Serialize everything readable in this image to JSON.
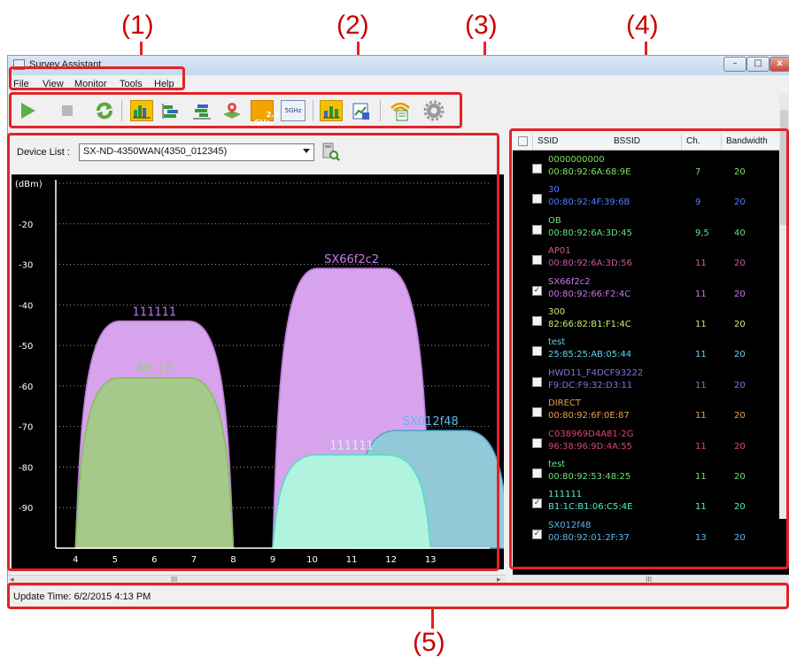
{
  "callouts": [
    "(1)",
    "(2)",
    "(3)",
    "(4)",
    "(5)"
  ],
  "window": {
    "title": "Survey Assistant",
    "buttons": {
      "minimize": "–",
      "maximize": "□",
      "close": "x"
    }
  },
  "menu": [
    "File",
    "View",
    "Monitor",
    "Tools",
    "Help"
  ],
  "toolbar": [
    "play-icon",
    "stop-icon",
    "refresh-icon",
    "channel-graph-icon",
    "channel-graph-alt-icon",
    "time-graph-icon",
    "map-icon",
    "2.4 GHz",
    "5GHz",
    "bar-graph-icon",
    "report-icon",
    "wifi-list-icon",
    "gear-icon"
  ],
  "toolbar_labels": {
    "band24": "2.4\nGHz",
    "band5": "5GHz"
  },
  "device": {
    "label": "Device List :",
    "selected": "SX-ND-4350WAN(4350_012345)"
  },
  "list": {
    "headers": [
      "SSID",
      "BSSID",
      "Ch.",
      "Bandwidth"
    ],
    "rows": [
      {
        "ssid": "0000000000",
        "bssid": "00:80:92:6A:68:9E",
        "ch": "7",
        "bw": "20",
        "checked": false,
        "color": "#7fe35f"
      },
      {
        "ssid": "30",
        "bssid": "00:80:92:4F:39:6B",
        "ch": "9",
        "bw": "20",
        "checked": false,
        "color": "#4f7fff"
      },
      {
        "ssid": "OB",
        "bssid": "00:80:92:6A:3D:45",
        "ch": "9,5",
        "bw": "40",
        "checked": false,
        "color": "#63e08a"
      },
      {
        "ssid": "AP01",
        "bssid": "00:80:92:6A:3D:56",
        "ch": "11",
        "bw": "20",
        "checked": false,
        "color": "#d0589f"
      },
      {
        "ssid": "SX66f2c2",
        "bssid": "00:80:92:66:F2:4C",
        "ch": "11",
        "bw": "20",
        "checked": true,
        "color": "#c77ae8"
      },
      {
        "ssid": "300",
        "bssid": "82:66:82:B1:F1:4C",
        "ch": "11",
        "bw": "20",
        "checked": false,
        "color": "#c5f06a"
      },
      {
        "ssid": "test",
        "bssid": "25:85:25:AB:05:44",
        "ch": "11",
        "bw": "20",
        "checked": false,
        "color": "#5fd6ef"
      },
      {
        "ssid": "HWD11_F4DCF93222",
        "bssid": "F9:DC:F9:32:D3:11",
        "ch": "11",
        "bw": "20",
        "checked": false,
        "color": "#8a6fd8"
      },
      {
        "ssid": "DIRECT",
        "bssid": "00:80:92:6F:0E:87",
        "ch": "11",
        "bw": "20",
        "checked": false,
        "color": "#e8a24c"
      },
      {
        "ssid": "C038969D4A81-2G",
        "bssid": "96:38:96:9D:4A:55",
        "ch": "11",
        "bw": "20",
        "checked": false,
        "color": "#e0466c"
      },
      {
        "ssid": "test",
        "bssid": "00:80:92:53:48:25",
        "ch": "11",
        "bw": "20",
        "checked": false,
        "color": "#6ee07a"
      },
      {
        "ssid": "111111",
        "bssid": "B1:1C:B1:06:C5:4E",
        "ch": "11",
        "bw": "20",
        "checked": true,
        "color": "#4ff0d0"
      },
      {
        "ssid": "SX012f48",
        "bssid": "00:80:92:01:2F:37",
        "ch": "13",
        "bw": "20",
        "checked": true,
        "color": "#5fb8f0"
      }
    ]
  },
  "scroll_marks": {
    "left": "III",
    "right": "III"
  },
  "status": {
    "text": "Update Time: 6/2/2015 4:13 PM"
  },
  "chart_data": {
    "type": "area",
    "ylabel": "(dBm)",
    "ylim": [
      -100,
      -10
    ],
    "yticks": [
      -20,
      -30,
      -40,
      -50,
      -60,
      -70,
      -80,
      -90
    ],
    "xlim": [
      3.5,
      14.5
    ],
    "xticks": [
      4,
      5,
      6,
      7,
      8,
      9,
      10,
      11,
      12,
      13
    ],
    "grid": true,
    "series": [
      {
        "name": "111111",
        "center": 6,
        "width": 4,
        "peak": -44,
        "fill": "#d7a3ec",
        "stroke": "#b777d6",
        "label_color": "#b777e8"
      },
      {
        "name": "AP_12",
        "center": 6,
        "width": 4,
        "peak": -58,
        "fill": "#a6c88b",
        "stroke": "#7fbf5a",
        "label_color": "#8fd07a"
      },
      {
        "name": "SX66f2c2",
        "center": 11,
        "width": 4,
        "peak": -31,
        "fill": "#d7a3ec",
        "stroke": "#b777d6",
        "label_color": "#c77ae8"
      },
      {
        "name": "SX012f48",
        "center": 13,
        "width": 4,
        "peak": -71,
        "fill": "#92c8d8",
        "stroke": "#4fa6c8",
        "label_color": "#5fb8f0"
      },
      {
        "name": "111111",
        "center": 11,
        "width": 4,
        "peak": -77,
        "fill": "#b0f4e0",
        "stroke": "#4fe0c0",
        "label_color": "#c8f8ea"
      }
    ]
  }
}
